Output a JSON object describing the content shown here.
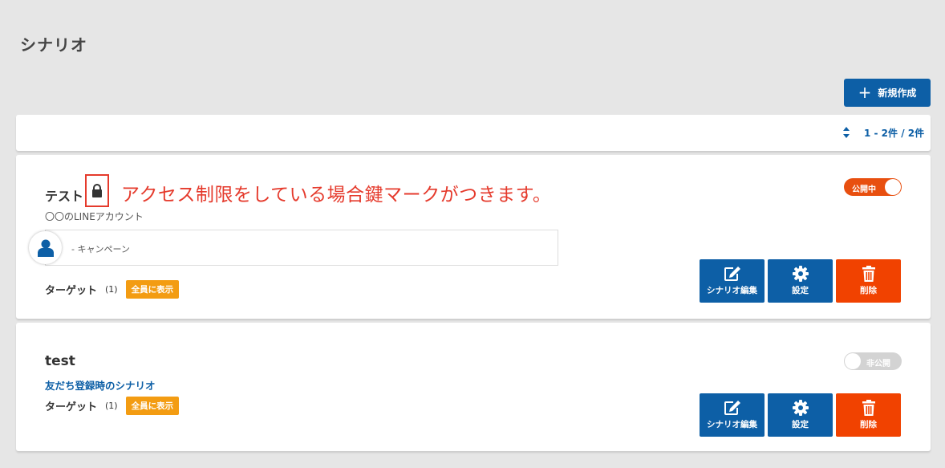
{
  "page": {
    "title": "シナリオ"
  },
  "toolbar": {
    "new_label": "新規作成"
  },
  "pager": {
    "text": "1 - 2件 / 2件"
  },
  "scenarios": [
    {
      "title": "テスト",
      "annotation": "アクセス制限をしている場合鍵マークがつきます。",
      "account": "〇〇のLINEアカウント",
      "campaign": "- キャンペーン",
      "target_label": "ターゲット",
      "target_count": "(1)",
      "target_badge": "全員に表示",
      "status": "公開中",
      "edit_label": "シナリオ編集",
      "settings_label": "設定",
      "delete_label": "削除"
    },
    {
      "title": "test",
      "subtitle": "友だち登録時のシナリオ",
      "target_label": "ターゲット",
      "target_count": "(1)",
      "target_badge": "全員に表示",
      "status": "非公開",
      "edit_label": "シナリオ編集",
      "settings_label": "設定",
      "delete_label": "削除"
    }
  ],
  "colors": {
    "primary": "#0d5fa6",
    "danger": "#f14200",
    "badge": "#f39c12",
    "annotation": "#e53a2c"
  }
}
